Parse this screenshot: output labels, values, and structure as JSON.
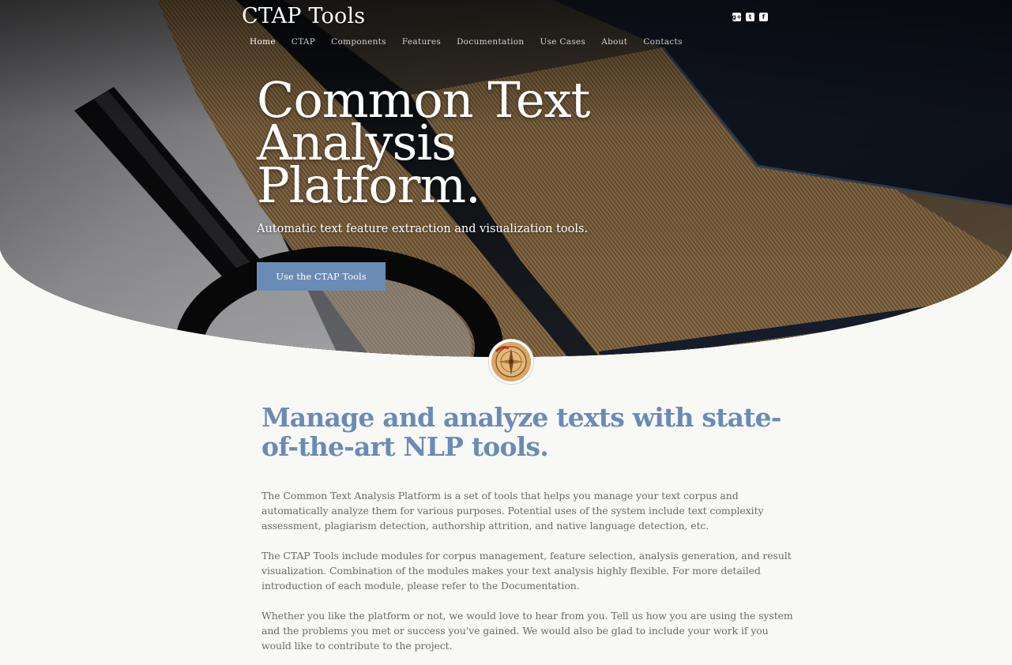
{
  "header": {
    "site_title": "CTAP Tools"
  },
  "social": [
    {
      "icon": "google-plus-icon",
      "glyph": "g+"
    },
    {
      "icon": "twitter-icon",
      "glyph": "t"
    },
    {
      "icon": "facebook-icon",
      "glyph": "f"
    }
  ],
  "nav": {
    "items": [
      {
        "label": "Home",
        "active": true
      },
      {
        "label": "CTAP"
      },
      {
        "label": "Components"
      },
      {
        "label": "Features"
      },
      {
        "label": "Documentation"
      },
      {
        "label": "Use Cases"
      },
      {
        "label": "About"
      },
      {
        "label": "Contacts"
      }
    ]
  },
  "hero": {
    "heading": "Common Text Analysis Platform.",
    "subtitle": "Automatic text feature extraction and visualization tools.",
    "cta_label": "Use the CTAP Tools"
  },
  "main": {
    "heading": "Manage and analyze texts with state-of-the-art NLP tools.",
    "paragraphs": [
      "The Common Text Analysis Platform is a set of tools that helps you manage your text corpus and automatically analyze them for various purposes. Potential uses of the system include text complexity assessment, plagiarism detection, authorship attrition, and native language detection, etc.",
      "The CTAP Tools include modules for corpus management, feature selection, analysis generation, and result visualization. Combination of the modules makes your text analysis highly flexible. For more detailed introduction of each module, please refer to the Documentation.",
      "Whether you like the platform or not, we would love to hear from you. Tell us how you are using the system and the problems you met or success you've gained. We would also be glad to include your work if you would like to contribute to the project."
    ]
  },
  "colors": {
    "accent": "#6a8bb5",
    "page_background": "#f8f8f5",
    "body_text": "#6a6a6a"
  }
}
